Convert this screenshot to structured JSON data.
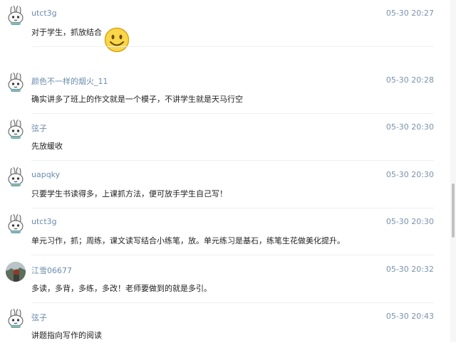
{
  "comments": [
    {
      "author": "utct3g",
      "time": "05-30 20:27",
      "text": "对于学生，抓放结合",
      "avatar": "bunny-avatar",
      "emoji": "smiley-face-icon"
    },
    {
      "author": "颜色不一样的烟火_11",
      "time": "05-30 20:28",
      "text": "确实讲多了班上的作文就是一个模子，不讲学生就是天马行空",
      "avatar": "bunny-avatar"
    },
    {
      "author": "弦子",
      "time": "05-30 20:30",
      "text": "先放缓收",
      "avatar": "bunny-avatar"
    },
    {
      "author": "uapqky",
      "time": "05-30 20:30",
      "text": "只要学生书读得多，上课抓方法，便可放手学生自己写！",
      "avatar": "bunny-avatar"
    },
    {
      "author": "utct3g",
      "time": "05-30 20:30",
      "text": "单元习作，抓；周练，课文读写结合小练笔，放。单元练习是基石，练笔生花做美化提升。",
      "avatar": "bunny-avatar"
    },
    {
      "author": "江雪06677",
      "time": "05-30 20:32",
      "text": "多读，多背，多练，多改！老师要做到的就是多引。",
      "avatar": "photo-avatar"
    },
    {
      "author": "弦子",
      "time": "05-30 20:43",
      "text": "讲题指向写作的阅读",
      "avatar": "bunny-avatar"
    }
  ],
  "colors": {
    "author": "#6b8cae",
    "time": "#7a93ad",
    "text": "#222222",
    "divider": "#eceff2"
  }
}
